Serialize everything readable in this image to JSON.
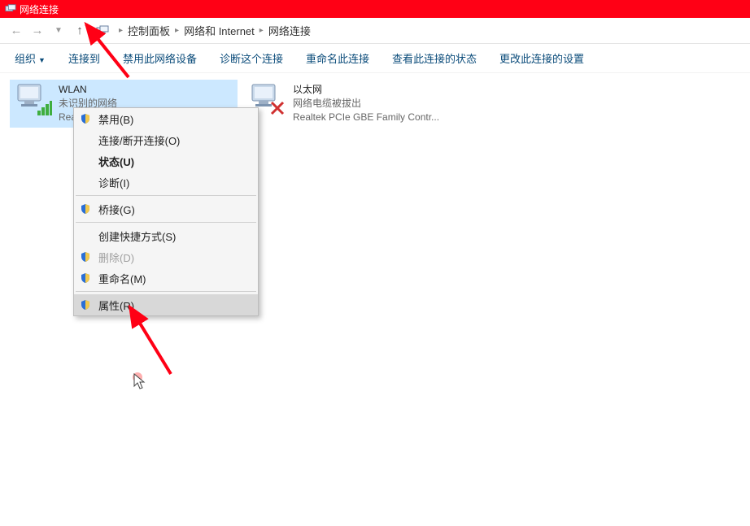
{
  "window": {
    "title": "网络连接"
  },
  "breadcrumb": {
    "items": [
      "控制面板",
      "网络和 Internet",
      "网络连接"
    ]
  },
  "cmdbar": {
    "organize": "组织",
    "connect": "连接到",
    "disable": "禁用此网络设备",
    "diagnose": "诊断这个连接",
    "rename": "重命名此连接",
    "status": "查看此连接的状态",
    "change": "更改此连接的设置"
  },
  "connections": {
    "wlan": {
      "name": "WLAN",
      "status": "未识别的网络",
      "adapter": "Rea..."
    },
    "ethernet": {
      "name": "以太网",
      "status": "网络电缆被拔出",
      "adapter": "Realtek PCIe GBE Family Contr..."
    }
  },
  "context_menu": {
    "disable": "禁用(B)",
    "connect": "连接/断开连接(O)",
    "status": "状态(U)",
    "diagnose": "诊断(I)",
    "bridge": "桥接(G)",
    "shortcut": "创建快捷方式(S)",
    "delete": "删除(D)",
    "rename": "重命名(M)",
    "properties": "属性(R)"
  }
}
